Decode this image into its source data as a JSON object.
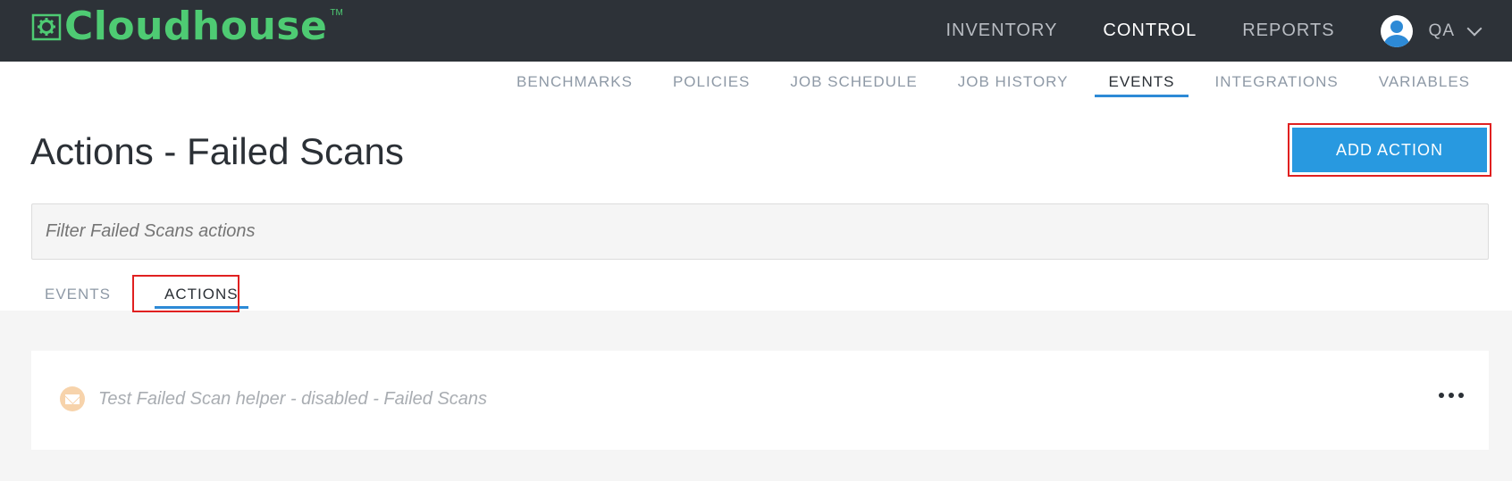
{
  "brand": {
    "name": "Cloudhouse",
    "tm": "TM"
  },
  "main_nav": [
    {
      "label": "INVENTORY",
      "active": false
    },
    {
      "label": "CONTROL",
      "active": true
    },
    {
      "label": "REPORTS",
      "active": false
    }
  ],
  "user": {
    "name": "QA"
  },
  "sub_nav": [
    {
      "label": "BENCHMARKS",
      "active": false
    },
    {
      "label": "POLICIES",
      "active": false
    },
    {
      "label": "JOB SCHEDULE",
      "active": false
    },
    {
      "label": "JOB HISTORY",
      "active": false
    },
    {
      "label": "EVENTS",
      "active": true
    },
    {
      "label": "INTEGRATIONS",
      "active": false
    },
    {
      "label": "VARIABLES",
      "active": false
    }
  ],
  "page": {
    "title": "Actions - Failed Scans",
    "add_button": "ADD ACTION",
    "filter_placeholder": "Filter Failed Scans actions"
  },
  "tabs": [
    {
      "label": "EVENTS",
      "active": false
    },
    {
      "label": "ACTIONS",
      "active": true
    }
  ],
  "actions": [
    {
      "text": "Test Failed Scan helper - disabled - Failed Scans",
      "icon": "mail-icon"
    }
  ],
  "colors": {
    "topbar": "#2d3238",
    "brand_green": "#4ecb73",
    "accent_blue": "#2899e0",
    "highlight_red": "#e02020"
  }
}
